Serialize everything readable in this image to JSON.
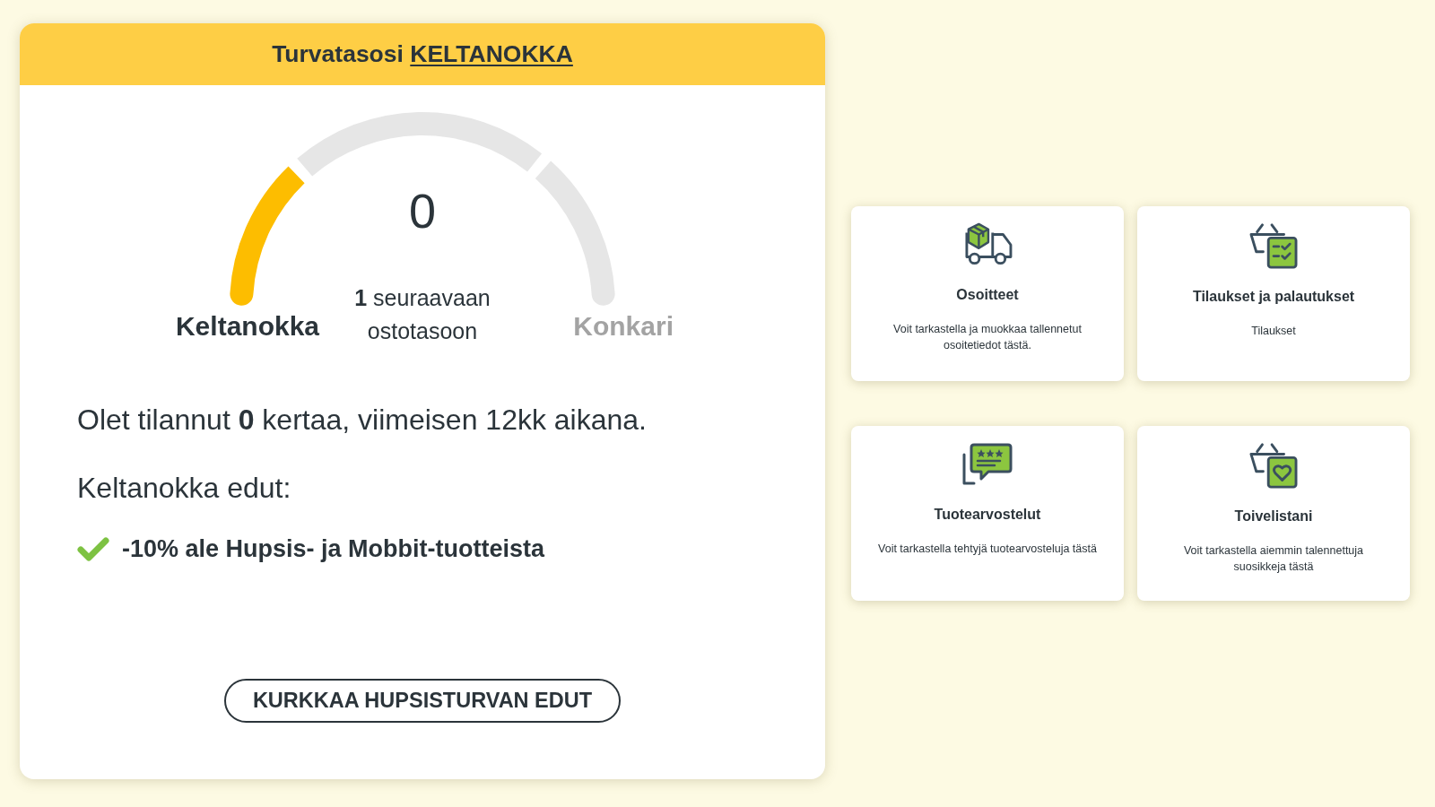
{
  "level_card": {
    "header": {
      "label": "Turvatasosi",
      "level_link": "KELTANOKKA"
    },
    "gauge": {
      "segments": [
        {
          "filled": true
        },
        {
          "filled": false
        },
        {
          "filled": false
        }
      ],
      "count": "0",
      "current_level": "Keltanokka",
      "to_next": "**1** seuraavaan ostotasoon",
      "next_level": "Konkari"
    },
    "order_summary": "Olet tilannut **0** kertaa, viimeisen 12kk aikana.",
    "benefits_title": "Keltanokka edut:",
    "benefits": [
      "-10% ale Hupsis- ja Mobbit-tuotteista"
    ],
    "button": "KURKKAA HUPSISTURVAN EDUT"
  },
  "shortcuts": [
    {
      "kind": "addresses",
      "title": "Osoitteet",
      "description": "Voit tarkastella ja muokkaa tallennetut osoitetiedot tästä."
    },
    {
      "kind": "orders",
      "title": "Tilaukset ja palautukset",
      "description": "Tilaukset"
    },
    {
      "kind": "reviews",
      "title": "Tuotearvostelut",
      "description": "Voit tarkastella tehtyjä tuotearvosteluja tästä"
    },
    {
      "kind": "wishlist",
      "title": "Toivelistani",
      "description": "Voit tarkastella aiemmin talennettuja suosikkeja tästä"
    }
  ]
}
